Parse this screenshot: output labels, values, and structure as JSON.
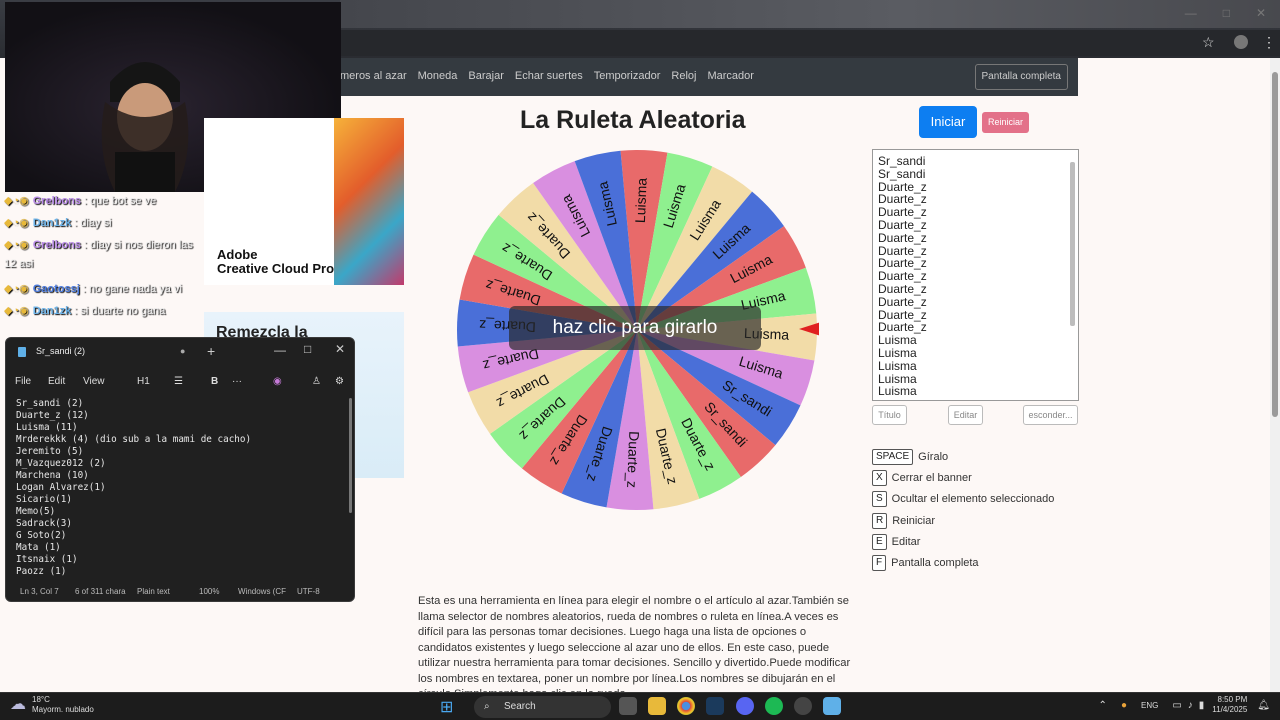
{
  "browser": {
    "bookmark_icon": "star-icon",
    "menu_icon": "more-vertical-icon"
  },
  "nav": {
    "links": [
      "meros al azar",
      "Moneda",
      "Barajar",
      "Echar suertes",
      "Temporizador",
      "Reloj",
      "Marcador"
    ],
    "fullscreen_label": "Pantalla completa"
  },
  "page": {
    "title": "La Ruleta Aleatoria",
    "start_label": "Iniciar",
    "reset_label": "Reiniciar",
    "spin_banner": "haz clic para girarlo",
    "names": [
      "Sr_sandi",
      "Sr_sandi",
      "Duarte_z",
      "Duarte_z",
      "Duarte_z",
      "Duarte_z",
      "Duarte_z",
      "Duarte_z",
      "Duarte_z",
      "Duarte_z",
      "Duarte_z",
      "Duarte_z",
      "Duarte_z",
      "Duarte_z",
      "Luisma",
      "Luisma",
      "Luisma",
      "Luisma",
      "Luisma"
    ],
    "title_button": "Título",
    "edit_button": "Editar",
    "hide_button": "esconder...",
    "shortcuts": [
      {
        "key": "SPACE",
        "label": "Gíralo"
      },
      {
        "key": "X",
        "label": "Cerrar el banner"
      },
      {
        "key": "S",
        "label": "Ocultar el elemento seleccionado"
      },
      {
        "key": "R",
        "label": "Reiniciar"
      },
      {
        "key": "E",
        "label": "Editar"
      },
      {
        "key": "F",
        "label": "Pantalla completa"
      }
    ],
    "description": "Esta es una herramienta en línea para elegir el nombre o el artículo al azar.También se llama selector de nombres aleatorios, rueda de nombres o ruleta en línea.A veces es difícil para las personas tomar decisiones. Luego haga una lista de opciones o candidatos existentes y luego seleccione al azar uno de ellos. En este caso, puede utilizar nuestra herramienta para tomar decisiones. Sencillo y divertido.Puede modificar los nombres en textarea, poner un nombre por línea.Los nombres se dibujarán en el círculo.Simplemente haga clic en la rueda"
  },
  "wheel": {
    "segments": [
      {
        "label": "Luisma",
        "color": "#e86a6a"
      },
      {
        "label": "Luisma",
        "color": "#8ff08f"
      },
      {
        "label": "Luisma",
        "color": "#f2dca8"
      },
      {
        "label": "Luisma",
        "color": "#4a6fd8"
      },
      {
        "label": "Luisma",
        "color": "#e86a6a"
      },
      {
        "label": "Luisma",
        "color": "#8ff08f"
      },
      {
        "label": "Luisma",
        "color": "#f2dca8"
      },
      {
        "label": "Luisma",
        "color": "#d98fe0"
      },
      {
        "label": "Sr_sandi",
        "color": "#4a6fd8"
      },
      {
        "label": "Sr_sandi",
        "color": "#e86a6a"
      },
      {
        "label": "Duarte_z",
        "color": "#8ff08f"
      },
      {
        "label": "Duarte_z",
        "color": "#f2dca8"
      },
      {
        "label": "Duarte_z",
        "color": "#d98fe0"
      },
      {
        "label": "Duarte_z",
        "color": "#4a6fd8"
      },
      {
        "label": "Duarte_z",
        "color": "#e86a6a"
      },
      {
        "label": "Duarte_z",
        "color": "#8ff08f"
      },
      {
        "label": "Duarte_z",
        "color": "#f2dca8"
      },
      {
        "label": "Duarte_z",
        "color": "#d98fe0"
      },
      {
        "label": "Duarte_z",
        "color": "#4a6fd8"
      },
      {
        "label": "Duarte_z",
        "color": "#e86a6a"
      },
      {
        "label": "Duarte_z",
        "color": "#8ff08f"
      },
      {
        "label": "Duarte_z",
        "color": "#f2dca8"
      },
      {
        "label": "Luisma",
        "color": "#d98fe0"
      },
      {
        "label": "Luisma",
        "color": "#4a6fd8"
      }
    ],
    "pointer_color": "#e02020"
  },
  "chat": {
    "messages": [
      {
        "user": "Grelbons",
        "text": ": que bot se ve",
        "color": "#b98be8"
      },
      {
        "user": "Dan1zk",
        "text": ": diay si",
        "color": "#6db3e8"
      },
      {
        "user": "Grelbons",
        "text": ": diay si nos dieron las",
        "color": "#b98be8"
      },
      {
        "user": "",
        "text": "12 asi",
        "color": "#eeeeee"
      },
      {
        "user": "Gaotossj",
        "text": ": no gane nada ya vi",
        "color": "#4b7be0"
      },
      {
        "user": "Dan1zk",
        "text": ": si duarte no gana",
        "color": "#6db3e8"
      }
    ]
  },
  "ads": {
    "adobe_text": "Adobe\nCreative Cloud Pro",
    "remix_text": "Remezcla la"
  },
  "notepad": {
    "tab_title": "Sr_sandi (2)",
    "menu": [
      "File",
      "Edit",
      "View"
    ],
    "heading_selector": "H1",
    "lines": "Sr_sandi (2)\nDuarte_z (12)\nLuisma (11)\nMrderekkk (4) (dio sub a la mami de cacho)\nJeremito (5)\nM_Vazquez012 (2)\nMarchena (10)\nLogan Alvarez(1)\nSicario(1)\nMemo(5)\nSadrack(3)\nG Soto(2)\nMata (1)\nItsnaix (1)\nPaozz (1)",
    "status": {
      "position": "Ln 3, Col 7",
      "chars": "6 of 311 chara",
      "format": "Plain text",
      "zoom": "100%",
      "line_endings": "Windows (CF",
      "encoding": "UTF-8"
    }
  },
  "taskbar": {
    "temperature": "18°C",
    "weather": "Mayorm. nublado",
    "search": "Search",
    "language": "ENG",
    "time": "8:50 PM",
    "date": "11/4/2025"
  }
}
